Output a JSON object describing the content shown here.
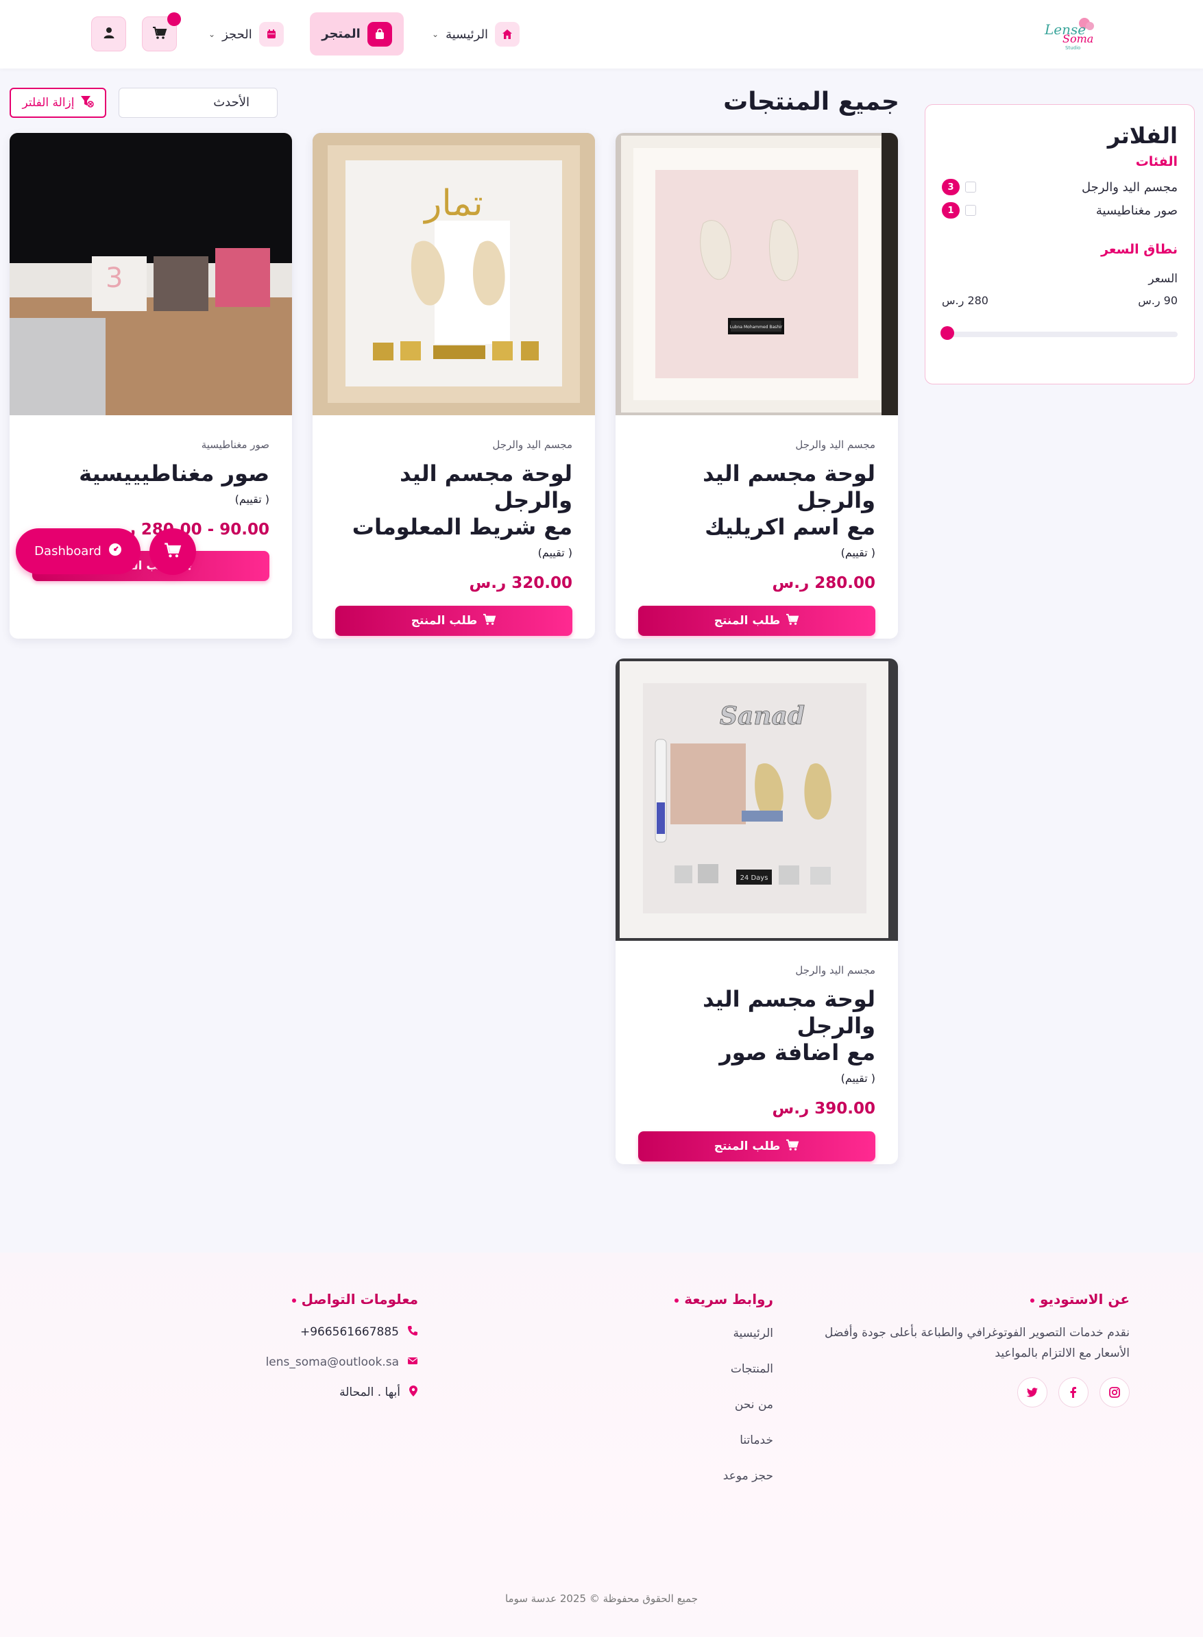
{
  "colors": {
    "accent": "#e6006f",
    "accent_light": "#fde0ee",
    "text": "#1c1c2c"
  },
  "header": {
    "logo_alt": "Lense Soma Studio",
    "nav": {
      "home_label": "الرئيسية",
      "store_label": "المتجر",
      "booking_label": "الحجز"
    },
    "icons": [
      "home-icon",
      "shopping-bag-icon",
      "calendar-icon",
      "cart-icon",
      "user-icon"
    ]
  },
  "filters": {
    "title": "الفلاتر",
    "categories_title": "الفئات",
    "categories": [
      {
        "label": "مجسم اليد والرجل",
        "count": "3"
      },
      {
        "label": "صور مغناطيسية",
        "count": "1"
      }
    ],
    "price_title": "نطاق السعر",
    "price_label": "السعر",
    "price_min": "90 ر.س",
    "price_max": "280 ر.س"
  },
  "main": {
    "title": "جميع المنتجات",
    "sort_value": "الأحدث",
    "clear_filter_label": "إزالة الفلتر"
  },
  "products": [
    {
      "category": "مجسم اليد والرجل",
      "name_line1": "لوحة مجسم اليد والرجل",
      "name_line2": "مع اسم اكريليك",
      "rating": "( تقييم)",
      "price": "280.00 ر.س",
      "order_label": "طلب المنتج",
      "image_text": "Lubna Mohammed Bashir"
    },
    {
      "category": "مجسم اليد والرجل",
      "name_line1": "لوحة مجسم اليد والرجل",
      "name_line2": "مع شريط المعلومات",
      "rating": "( تقييم)",
      "price": "320.00 ر.س",
      "order_label": "طلب المنتج",
      "image_text": "تمار"
    },
    {
      "category": "صور مغناطيسية",
      "name_line1": "صور مغناطيييسية",
      "name_line2": "",
      "rating": "( تقييم)",
      "price": "90.00 - 280.00 ر.س",
      "order_label": "طلب المنتج",
      "image_text": "3"
    },
    {
      "category": "مجسم اليد والرجل",
      "name_line1": "لوحة مجسم اليد والرجل",
      "name_line2": "مع اضافة صور",
      "rating": "( تقييم)",
      "price": "390.00 ر.س",
      "order_label": "طلب المنتج",
      "image_text": "Sanad",
      "image_text2": "24 Days"
    }
  ],
  "floating": {
    "dashboard_label": "Dashboard"
  },
  "footer": {
    "about_title": "عن الاستوديو",
    "about_text": "نقدم خدمات التصوير الفوتوغرافي والطباعة بأعلى جودة وأفضل الأسعار مع الالتزام بالمواعيد",
    "social": [
      "instagram-icon",
      "facebook-icon",
      "twitter-icon"
    ],
    "links_title": "روابط سريعة",
    "links": [
      "الرئيسية",
      "المنتجات",
      "من نحن",
      "خدماتنا",
      "حجز موعد"
    ],
    "contact_title": "معلومات التواصل",
    "phone": "+966561667885",
    "email": "lens_soma@outlook.sa",
    "address": "أبها . المحالة",
    "copyright": "جميع الحقوق محفوظة © 2025 عدسة سوما"
  }
}
